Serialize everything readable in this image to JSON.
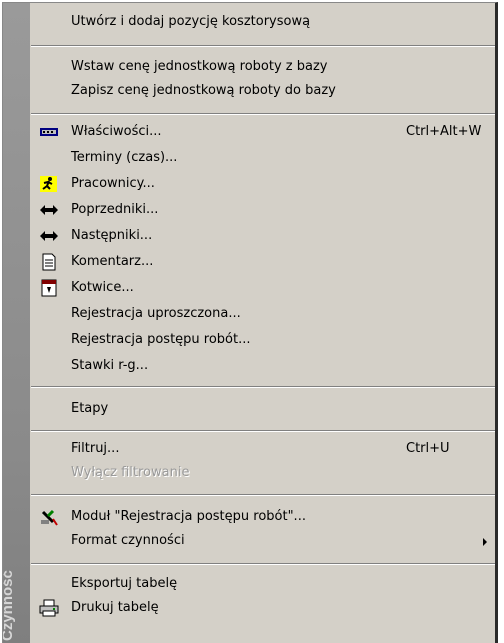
{
  "sidebar_title": "Czynność",
  "items": {
    "create_cost_item": "Utwórz i dodaj pozycję kosztorysową",
    "insert_unit_price": "Wstaw cenę jednostkową roboty z bazy",
    "save_unit_price": "Zapisz cenę jednostkową roboty do bazy",
    "properties": "Właściwości...",
    "properties_shortcut": "Ctrl+Alt+W",
    "terms": "Terminy (czas)...",
    "workers": "Pracownicy...",
    "predecessors": "Poprzedniki...",
    "successors": "Następniki...",
    "comment": "Komentarz...",
    "anchors": "Kotwice...",
    "simple_registration": "Rejestracja uproszczona...",
    "progress_registration": "Rejestracja postępu robót...",
    "rates": "Stawki r-g...",
    "stages": "Etapy",
    "filter": "Filtruj...",
    "filter_shortcut": "Ctrl+U",
    "disable_filter": "Wyłącz filtrowanie",
    "progress_module": "Moduł \"Rejestracja postępu robót\"...",
    "activity_format": "Format czynności",
    "export_table": "Eksportuj tabelę",
    "print_table": "Drukuj tabelę"
  },
  "icons": {
    "properties": "properties-icon",
    "workers": "running-man-icon",
    "predecessors": "double-arrow-icon",
    "successors": "double-arrow-icon",
    "comment": "document-icon",
    "anchors": "calendar-anchor-icon",
    "progress_module": "registration-tools-icon",
    "print_table": "printer-icon"
  }
}
